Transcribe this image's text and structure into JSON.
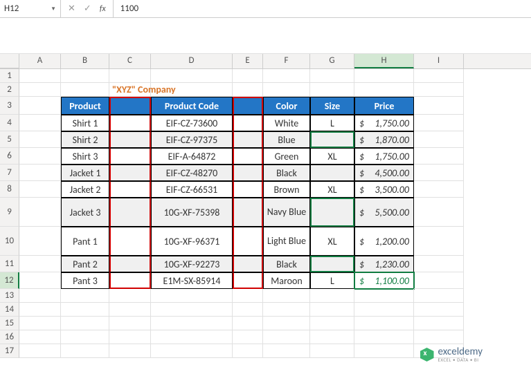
{
  "name_box": "H12",
  "formula_value": "1100",
  "columns": [
    "A",
    "B",
    "C",
    "D",
    "E",
    "F",
    "G",
    "H",
    "I"
  ],
  "row_numbers": [
    1,
    2,
    3,
    4,
    5,
    6,
    7,
    8,
    9,
    10,
    11,
    12,
    13,
    14,
    15,
    16,
    17
  ],
  "active_col": "H",
  "active_row": 12,
  "title": "\"XYZ\" Company",
  "headers": {
    "B": "Product",
    "C": "",
    "D": "Product Code",
    "E": "",
    "F": "Color",
    "G": "Size",
    "H": "Price"
  },
  "rows": [
    {
      "product": "Shirt 1",
      "code": "EIF-CZ-73600",
      "color": "White",
      "size": "L",
      "price": "1,750.00",
      "alt": false,
      "tall": false
    },
    {
      "product": "Shirt 2",
      "code": "EIF-CZ-97375",
      "color": "Blue",
      "size": "",
      "price": "1,870.00",
      "alt": true,
      "tall": false,
      "sizegreen": true
    },
    {
      "product": "Shirt 3",
      "code": "EIF-A-64872",
      "color": "Green",
      "size": "XL",
      "price": "1,750.00",
      "alt": false,
      "tall": false
    },
    {
      "product": "Jacket 1",
      "code": "EIF-CZ-48270",
      "color": "Black",
      "size": "",
      "price": "4,500.00",
      "alt": true,
      "tall": false
    },
    {
      "product": "Jacket 2",
      "code": "EIF-CZ-66531",
      "color": "Brown",
      "size": "XL",
      "price": "3,500.00",
      "alt": false,
      "tall": false
    },
    {
      "product": "Jacket 3",
      "code": "10G-XF-75398",
      "color": "Navy Blue",
      "size": "",
      "price": "5,500.00",
      "alt": true,
      "tall": true,
      "sizegreen": true
    },
    {
      "product": "Pant 1",
      "code": "10G-XF-96371",
      "color": "Light Blue",
      "size": "XL",
      "price": "1,200.00",
      "alt": false,
      "tall": true
    },
    {
      "product": "Pant 2",
      "code": "10G-XF-92273",
      "color": "Black",
      "size": "",
      "price": "1,230.00",
      "alt": true,
      "tall": false,
      "sizegreen": true
    },
    {
      "product": "Pant 3",
      "code": "E1M-SX-85914",
      "color": "Maroon",
      "size": "L",
      "price": "1,100.00",
      "alt": false,
      "tall": false,
      "active": true
    }
  ],
  "watermark": {
    "main": "exceldemy",
    "sub": "EXCEL • DATA • BI"
  },
  "chart_data": {
    "type": "table",
    "title": "\"XYZ\" Company",
    "columns": [
      "Product",
      "Product Code",
      "Color",
      "Size",
      "Price"
    ],
    "data": [
      [
        "Shirt 1",
        "EIF-CZ-73600",
        "White",
        "L",
        1750.0
      ],
      [
        "Shirt 2",
        "EIF-CZ-97375",
        "Blue",
        "",
        1870.0
      ],
      [
        "Shirt 3",
        "EIF-A-64872",
        "Green",
        "XL",
        1750.0
      ],
      [
        "Jacket 1",
        "EIF-CZ-48270",
        "Black",
        "",
        4500.0
      ],
      [
        "Jacket 2",
        "EIF-CZ-66531",
        "Brown",
        "XL",
        3500.0
      ],
      [
        "Jacket 3",
        "10G-XF-75398",
        "Navy Blue",
        "",
        5500.0
      ],
      [
        "Pant 1",
        "10G-XF-96371",
        "Light Blue",
        "XL",
        1200.0
      ],
      [
        "Pant 2",
        "10G-XF-92273",
        "Black",
        "",
        1230.0
      ],
      [
        "Pant 3",
        "E1M-SX-85914",
        "Maroon",
        "L",
        1100.0
      ]
    ]
  }
}
